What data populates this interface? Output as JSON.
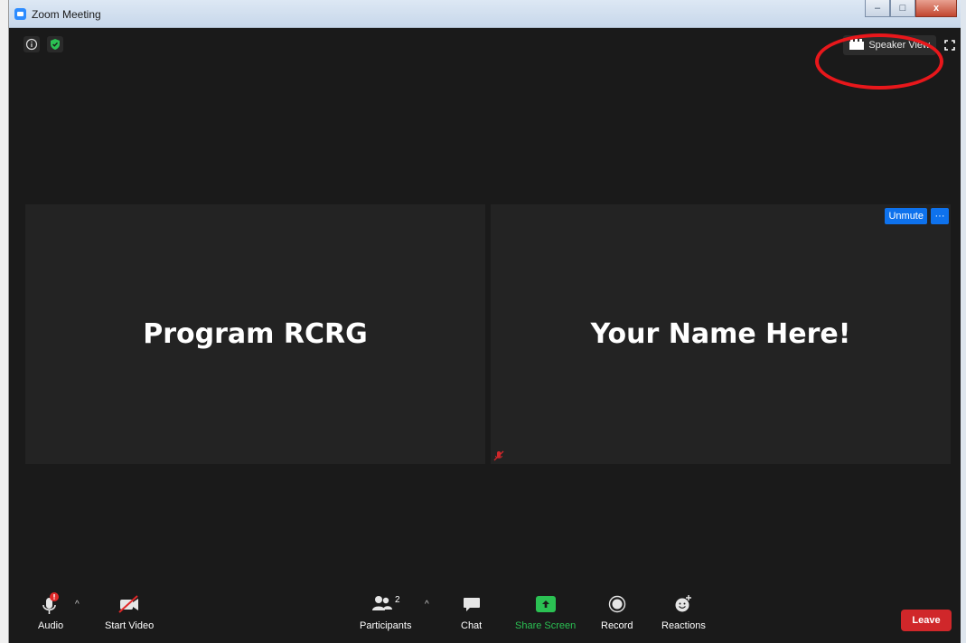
{
  "window": {
    "title": "Zoom Meeting",
    "controls": {
      "minimize": "–",
      "maximize": "□",
      "close": "x"
    }
  },
  "top_bar": {
    "info_icon": "info-icon",
    "security_icon": "shield-icon",
    "speaker_view_label": "Speaker View",
    "speaker_view_icon": "gallery-grid-icon",
    "fullscreen_icon": "fullscreen-icon"
  },
  "tiles": [
    {
      "name": "Program RCRG"
    },
    {
      "name": "Your Name Here!",
      "unmute_label": "Unmute",
      "more_label": "···",
      "status_icon": "muted-mic-icon"
    }
  ],
  "toolbar": {
    "audio_label": "Audio",
    "start_video_label": "Start Video",
    "participants_label": "Participants",
    "participants_count": "2",
    "chat_label": "Chat",
    "share_screen_label": "Share Screen",
    "record_label": "Record",
    "reactions_label": "Reactions",
    "leave_label": "Leave"
  },
  "colors": {
    "meeting_bg": "#1a1a1a",
    "tile_bg": "#232323",
    "accent_blue": "#0e72ed",
    "share_green": "#2bc153",
    "leave_red": "#d0272a",
    "annotation_red": "#e8171b"
  }
}
